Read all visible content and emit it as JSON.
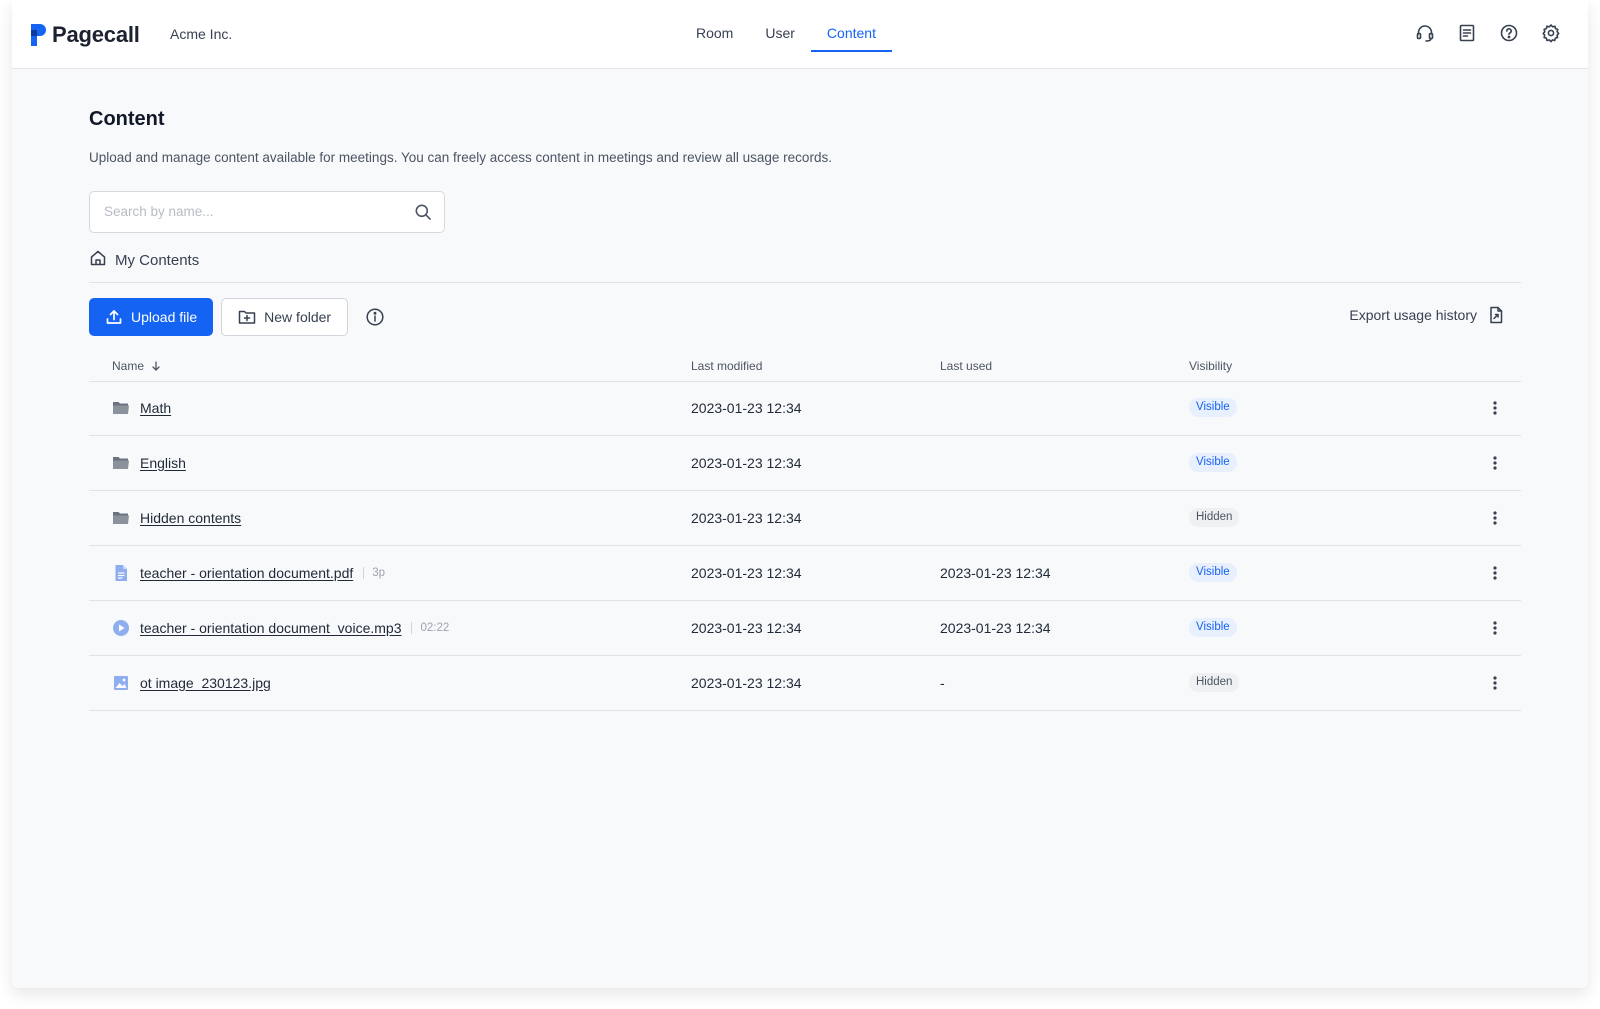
{
  "header": {
    "logo_text": "Pagecall",
    "org_name": "Acme Inc.",
    "nav": [
      {
        "label": "Room",
        "active": false
      },
      {
        "label": "User",
        "active": false
      },
      {
        "label": "Content",
        "active": true
      }
    ],
    "icons": [
      "headset-icon",
      "document-icon",
      "help-icon",
      "gear-icon"
    ]
  },
  "page": {
    "title": "Content",
    "description": "Upload and manage content available for meetings. You can freely access content in meetings and review all usage records.",
    "search_placeholder": "Search by name...",
    "search_value": "",
    "breadcrumb": "My Contents"
  },
  "toolbar": {
    "upload_label": "Upload file",
    "new_folder_label": "New folder",
    "export_label": "Export usage history"
  },
  "table": {
    "columns": {
      "name": "Name",
      "last_modified": "Last modified",
      "last_used": "Last used",
      "visibility": "Visibility"
    },
    "rows": [
      {
        "type": "folder",
        "name": "Math",
        "meta": "",
        "last_modified": "2023-01-23 12:34",
        "last_used": "",
        "visibility": "Visible"
      },
      {
        "type": "folder",
        "name": "English",
        "meta": "",
        "last_modified": "2023-01-23 12:34",
        "last_used": "",
        "visibility": "Visible"
      },
      {
        "type": "folder",
        "name": "Hidden contents",
        "meta": "",
        "last_modified": "2023-01-23 12:34",
        "last_used": "",
        "visibility": "Hidden"
      },
      {
        "type": "pdf",
        "name": "teacher - orientation document.pdf",
        "meta": "3p",
        "last_modified": "2023-01-23 12:34",
        "last_used": "2023-01-23 12:34",
        "visibility": "Visible"
      },
      {
        "type": "audio",
        "name": "teacher - orientation document_voice.mp3",
        "meta": "02:22",
        "last_modified": "2023-01-23 12:34",
        "last_used": "2023-01-23 12:34",
        "visibility": "Visible"
      },
      {
        "type": "image",
        "name": "ot image_230123.jpg",
        "meta": "",
        "last_modified": "2023-01-23 12:34",
        "last_used": "-",
        "visibility": "Hidden"
      }
    ]
  },
  "colors": {
    "accent": "#1463f3",
    "badge_visible_bg": "#e9f0fd",
    "badge_hidden_bg": "#eef0f2"
  }
}
